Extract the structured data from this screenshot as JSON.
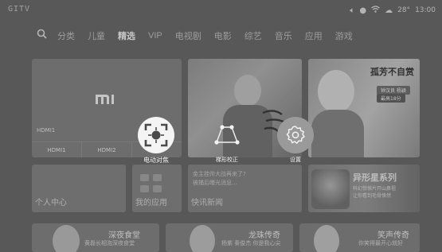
{
  "topbar": {
    "brand": "GITV",
    "status_icons": [
      "volume-icon",
      "headset-icon",
      "wifi-icon",
      "weather-icon"
    ],
    "temperature": "28°",
    "time": "13:00"
  },
  "nav": {
    "search_icon": "search-icon",
    "tabs": [
      "分类",
      "儿童",
      "精选",
      "VIP",
      "电视剧",
      "电影",
      "综艺",
      "音乐",
      "应用",
      "游戏"
    ],
    "active_tab": "精选"
  },
  "tiles": {
    "hdmi": {
      "logo_text": "mi",
      "input_label": "HDMI1",
      "sources": [
        "HDMI1",
        "HDMI2"
      ]
    },
    "poster2": {
      "title": "孤芳不自赏",
      "pill1": "钟汉良 杨颖",
      "pill2": "最高18分"
    },
    "user": {
      "label": "个人中心"
    },
    "apps": {
      "label": "我的应用"
    },
    "news": {
      "lines": [
        "金主挂帅大战再来了?",
        "被捕后曝光消息…"
      ],
      "label": "快讯新闻"
    },
    "promo": {
      "title": "异形星系列",
      "sub_lines": [
        "科幻惊悚片开山鼻祖",
        "让你看到毛骨悚然"
      ]
    },
    "bottom": [
      {
        "title": "深夜食堂",
        "sub": "黄磊长相泡深夜食堂"
      },
      {
        "title": "龙珠传奇",
        "sub": "杨紫 秦俊杰 你是我心尖"
      },
      {
        "title": "笑声传奇",
        "sub": "你笑得最开心就好"
      }
    ]
  },
  "quick_menu": {
    "items": [
      {
        "id": "focus",
        "label": "电动对焦",
        "icon": "focus-icon",
        "state": "selected"
      },
      {
        "id": "keystone",
        "label": "梯形校正",
        "icon": "keystone-icon",
        "state": "normal"
      },
      {
        "id": "settings",
        "label": "设置",
        "icon": "gear-icon",
        "state": "normal"
      }
    ]
  }
}
